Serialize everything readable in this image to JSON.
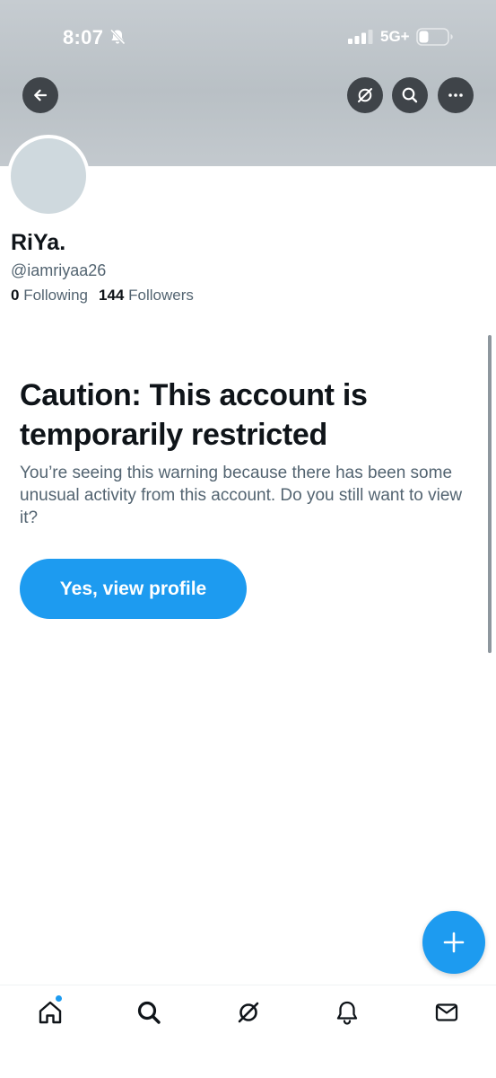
{
  "status_bar": {
    "time": "8:07",
    "network": "5G+"
  },
  "profile": {
    "display_name": "RiYa.",
    "handle": "@iamriyaa26",
    "following_count": "0",
    "following_label": "Following",
    "followers_count": "144",
    "followers_label": "Followers"
  },
  "warning": {
    "title": "Caution: This account is temporarily restricted",
    "body": "You’re seeing this warning because there has been some unusual activity from this account. Do you still want to view it?",
    "button_label": "Yes, view profile"
  },
  "icons": {
    "header": [
      "back-arrow-icon",
      "grok-icon",
      "search-icon",
      "more-icon"
    ],
    "tabs": [
      "home-icon",
      "search-icon",
      "grok-icon",
      "bell-icon",
      "mail-icon"
    ],
    "fab": "plus-icon"
  },
  "colors": {
    "accent": "#1d9bf0",
    "text_primary": "#0f1419",
    "text_secondary": "#536471",
    "banner": "#c0c7cc"
  }
}
